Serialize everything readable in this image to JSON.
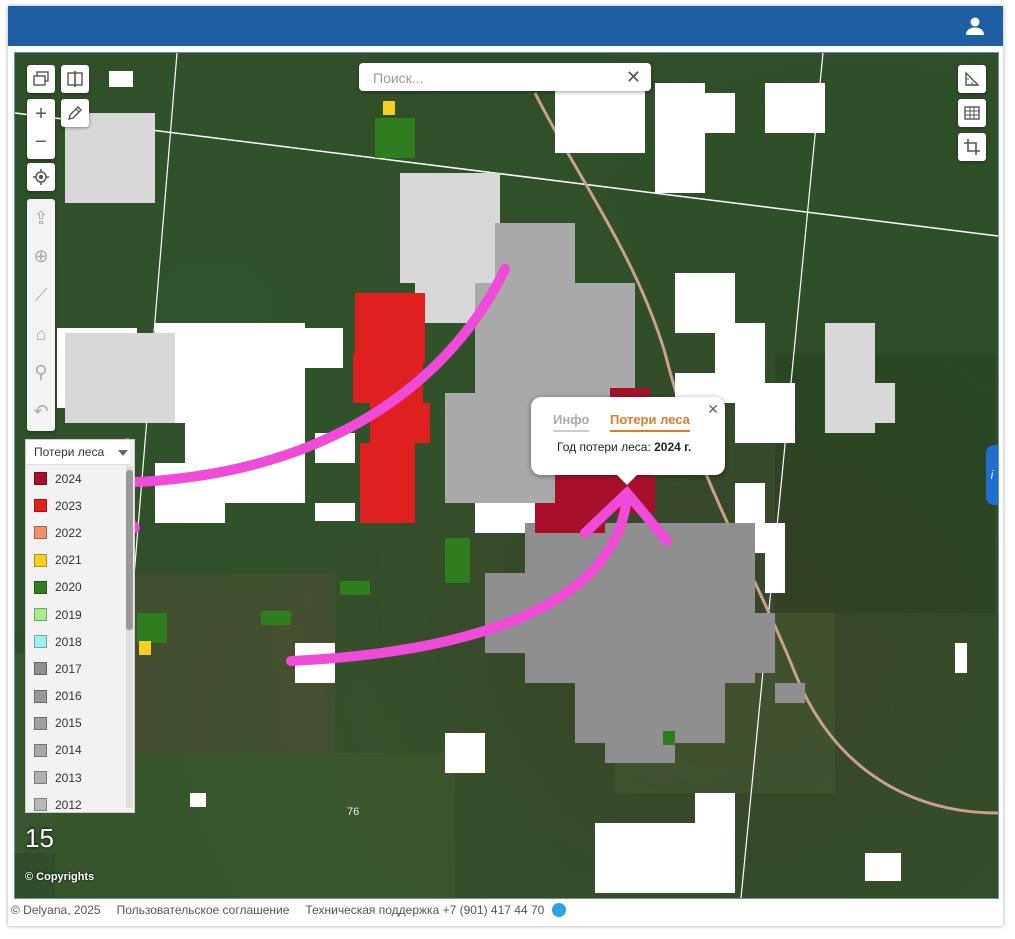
{
  "header": {
    "user_icon": "user-icon"
  },
  "search": {
    "placeholder": "Поиск...",
    "clear_label": "✕"
  },
  "map": {
    "zoom_level": "15",
    "copyright": "© Copyrights",
    "contour_label": "76",
    "info_tab_label": "i"
  },
  "legend": {
    "title": "Потери леса",
    "items": [
      {
        "label": "2024",
        "color": "#a8102a"
      },
      {
        "label": "2023",
        "color": "#e0201e"
      },
      {
        "label": "2022",
        "color": "#f0906c"
      },
      {
        "label": "2021",
        "color": "#f5d020"
      },
      {
        "label": "2020",
        "color": "#2e7d1e"
      },
      {
        "label": "2019",
        "color": "#a6ef8a"
      },
      {
        "label": "2018",
        "color": "#9cf2f0"
      },
      {
        "label": "2017",
        "color": "#909090"
      },
      {
        "label": "2016",
        "color": "#989898"
      },
      {
        "label": "2015",
        "color": "#a0a0a0"
      },
      {
        "label": "2014",
        "color": "#a8a8a8"
      },
      {
        "label": "2013",
        "color": "#b0b0b0"
      },
      {
        "label": "2012",
        "color": "#b8b8b8"
      }
    ]
  },
  "popup": {
    "tab_info": "Инфо",
    "tab_loss": "Потери леса",
    "field_label": "Год потери леса:",
    "field_value": "2024 г.",
    "close": "✕"
  },
  "footer": {
    "copyright": "© Delyana, 2025",
    "agreement": "Пользовательское соглашение",
    "support": "Техническая поддержка +7 (901) 417 44 70"
  },
  "colors": {
    "header": "#1e5fa3",
    "arrow": "#f04ad8",
    "accent": "#e07b2c"
  }
}
